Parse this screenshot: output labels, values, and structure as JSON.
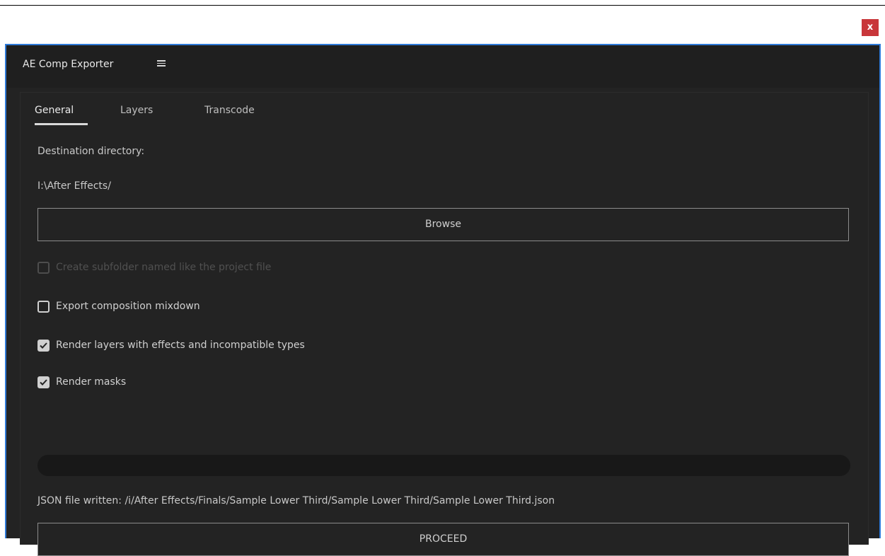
{
  "window": {
    "close_glyph": "x"
  },
  "panel": {
    "title": "AE Comp Exporter",
    "menu_icon": "hamburger-menu-icon"
  },
  "tabs": [
    {
      "label": "General",
      "active": true
    },
    {
      "label": "Layers",
      "active": false
    },
    {
      "label": "Transcode",
      "active": false
    }
  ],
  "general": {
    "destination_label": "Destination directory:",
    "destination_value": "I:\\After Effects/",
    "browse_label": "Browse",
    "options": [
      {
        "label": "Create subfolder named like the project file",
        "checked": false,
        "disabled": true
      },
      {
        "label": "Export composition mixdown",
        "checked": false,
        "disabled": false
      },
      {
        "label": "Render layers with effects and incompatible types",
        "checked": true,
        "disabled": false
      },
      {
        "label": "Render masks",
        "checked": true,
        "disabled": false
      }
    ],
    "progress": 0,
    "status_text": "JSON file written: /i/After Effects/Finals/Sample Lower Third/Sample Lower Third/Sample Lower Third.json",
    "proceed_label": "PROCEED"
  },
  "colors": {
    "accent": "#2f7ad8",
    "close": "#c8363a",
    "panel_bg": "#232323"
  }
}
